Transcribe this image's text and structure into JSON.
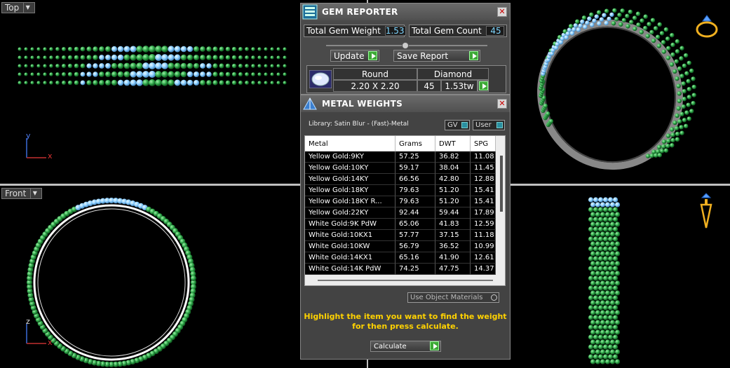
{
  "viewports": {
    "top": {
      "label": "Top",
      "axis_y": "y",
      "axis_x": "x"
    },
    "front": {
      "label": "Front",
      "axis_z": "z",
      "axis_x": "x"
    }
  },
  "gem_reporter": {
    "title": "GEM REPORTER",
    "total_gem_weight_label": "Total Gem Weight",
    "total_gem_weight": "1.53",
    "total_gem_count_label": "Total Gem Count",
    "total_gem_count": "45",
    "update_label": "Update",
    "save_report_label": "Save Report",
    "table": {
      "shape_header": "Round",
      "type_header": "Diamond",
      "size": "2.20 X 2.20",
      "count": "45",
      "weight": "1.53tw"
    }
  },
  "metal_weights": {
    "title": "METAL WEIGHTS",
    "library_text": "Library: Satin Blur - (Fast)-Metal",
    "gv_label": "GV",
    "user_label": "User",
    "columns": [
      "Metal",
      "Grams",
      "DWT",
      "SPG"
    ],
    "rows": [
      [
        "Yellow Gold:9KY",
        "57.25",
        "36.82",
        "11.08"
      ],
      [
        "Yellow Gold:10KY",
        "59.17",
        "38.04",
        "11.45"
      ],
      [
        "Yellow Gold:14KY",
        "66.56",
        "42.80",
        "12.88"
      ],
      [
        "Yellow Gold:18KY",
        "79.63",
        "51.20",
        "15.41"
      ],
      [
        "Yellow Gold:18KY R...",
        "79.63",
        "51.20",
        "15.41"
      ],
      [
        "Yellow Gold:22KY",
        "92.44",
        "59.44",
        "17.89"
      ],
      [
        "White Gold:9K PdW",
        "65.06",
        "41.83",
        "12.59"
      ],
      [
        "White Gold:10KX1",
        "57.77",
        "37.15",
        "11.18"
      ],
      [
        "White Gold:10KW",
        "56.79",
        "36.52",
        "10.99"
      ],
      [
        "White Gold:14KX1",
        "65.16",
        "41.90",
        "12.61"
      ],
      [
        "White Gold:14K PdW",
        "74.25",
        "47.75",
        "14.37"
      ]
    ],
    "use_object_materials_label": "Use Object Materials",
    "hint_line1": "Highlight the item you want to find the weight",
    "hint_line2": "for then press calculate.",
    "calculate_label": "Calculate"
  },
  "colors": {
    "gem_green": "#2fa84a",
    "gem_blue": "#8fd0ff",
    "hint_yellow": "#ffd200"
  }
}
